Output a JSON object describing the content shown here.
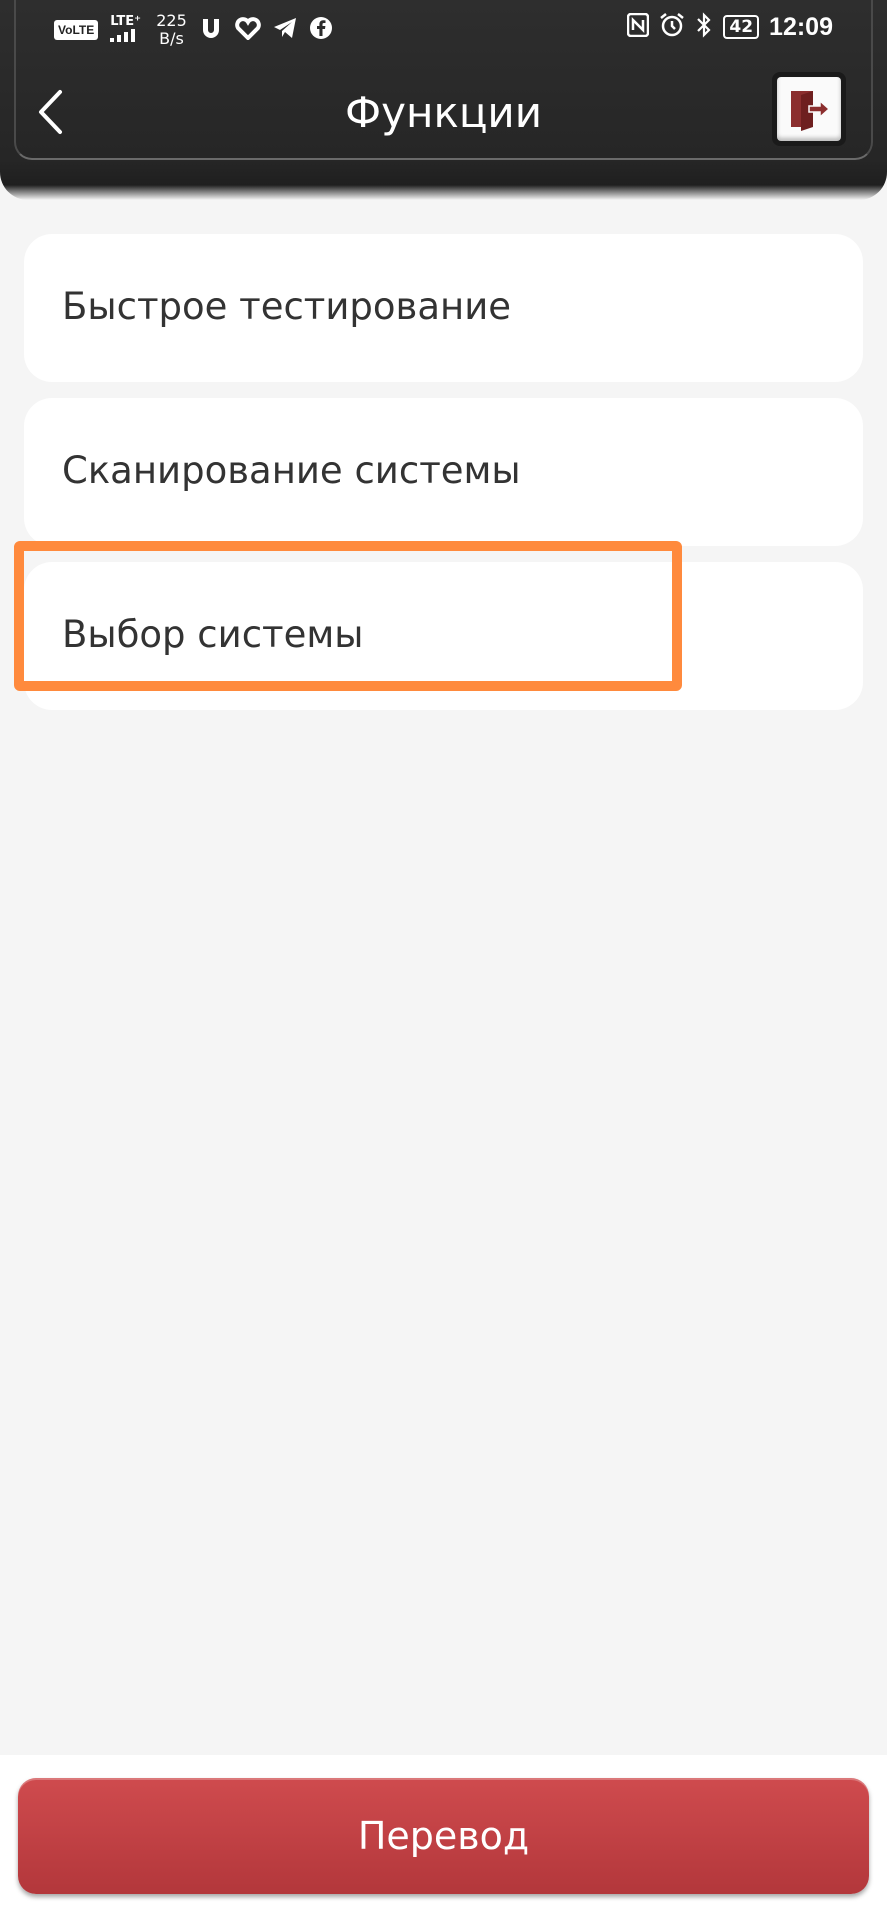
{
  "status_bar": {
    "volte": "VoLTE",
    "lte": "LTE⁺",
    "speed_value": "225",
    "speed_unit": "B/s",
    "battery": "42",
    "time": "12:09"
  },
  "header": {
    "title": "Функции"
  },
  "menu": {
    "items": [
      {
        "label": "Быстрое тестирование"
      },
      {
        "label": "Сканирование системы"
      },
      {
        "label": "Выбор системы"
      }
    ]
  },
  "footer": {
    "translate_label": "Перевод"
  },
  "colors": {
    "header_bg": "#2b2b2b",
    "accent_red": "#c0404a",
    "highlight_orange": "#ff8a3d",
    "exit_icon": "#8b2e2e"
  }
}
